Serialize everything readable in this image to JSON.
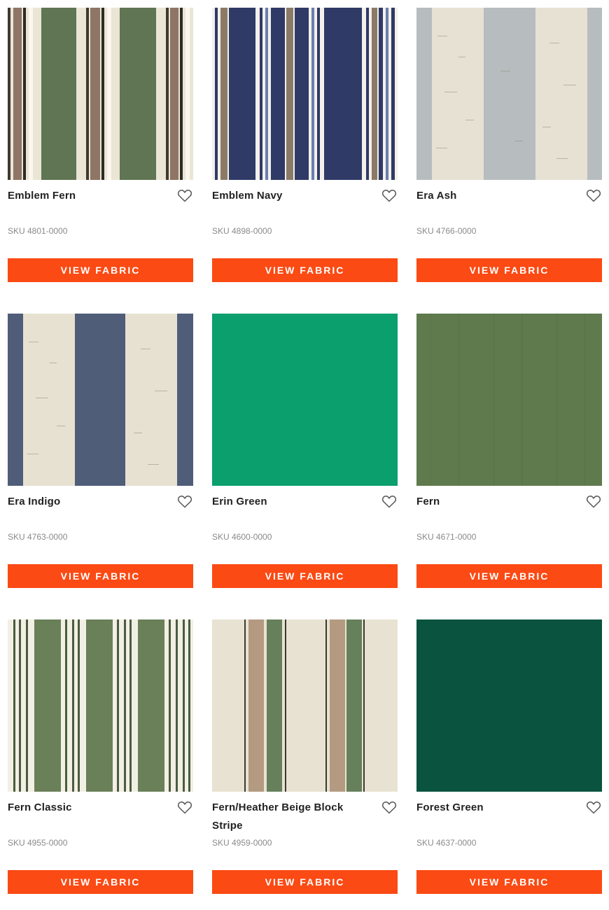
{
  "products": [
    {
      "name": "Emblem Fern",
      "sku": "SKU 4801-0000",
      "button": "VIEW FABRIC",
      "favorite_icon": "heart-outline-icon"
    },
    {
      "name": "Emblem Navy",
      "sku": "SKU 4898-0000",
      "button": "VIEW FABRIC",
      "favorite_icon": "heart-outline-icon"
    },
    {
      "name": "Era Ash",
      "sku": "SKU 4766-0000",
      "button": "VIEW FABRIC",
      "favorite_icon": "heart-outline-icon"
    },
    {
      "name": "Era Indigo",
      "sku": "SKU 4763-0000",
      "button": "VIEW FABRIC",
      "favorite_icon": "heart-outline-icon"
    },
    {
      "name": "Erin Green",
      "sku": "SKU 4600-0000",
      "button": "VIEW FABRIC",
      "favorite_icon": "heart-outline-icon"
    },
    {
      "name": "Fern",
      "sku": "SKU 4671-0000",
      "button": "VIEW FABRIC",
      "favorite_icon": "heart-outline-icon"
    },
    {
      "name": "Fern Classic",
      "sku": "SKU 4955-0000",
      "button": "VIEW FABRIC",
      "favorite_icon": "heart-outline-icon"
    },
    {
      "name": "Fern/Heather Beige Block Stripe",
      "sku": "SKU 4959-0000",
      "button": "VIEW FABRIC",
      "favorite_icon": "heart-outline-icon"
    },
    {
      "name": "Forest Green",
      "sku": "SKU 4637-0000",
      "button": "VIEW FABRIC",
      "favorite_icon": "heart-outline-icon"
    }
  ],
  "colors": {
    "accent": "#fb4a14",
    "erin_green": "#0a9f6c",
    "fern": "#5f7a4d",
    "forest_green": "#09533f",
    "navy": "#2e3a6b",
    "indigo": "#4f5d79",
    "ash": "#b6bcbd",
    "cream": "#ece6d6"
  }
}
